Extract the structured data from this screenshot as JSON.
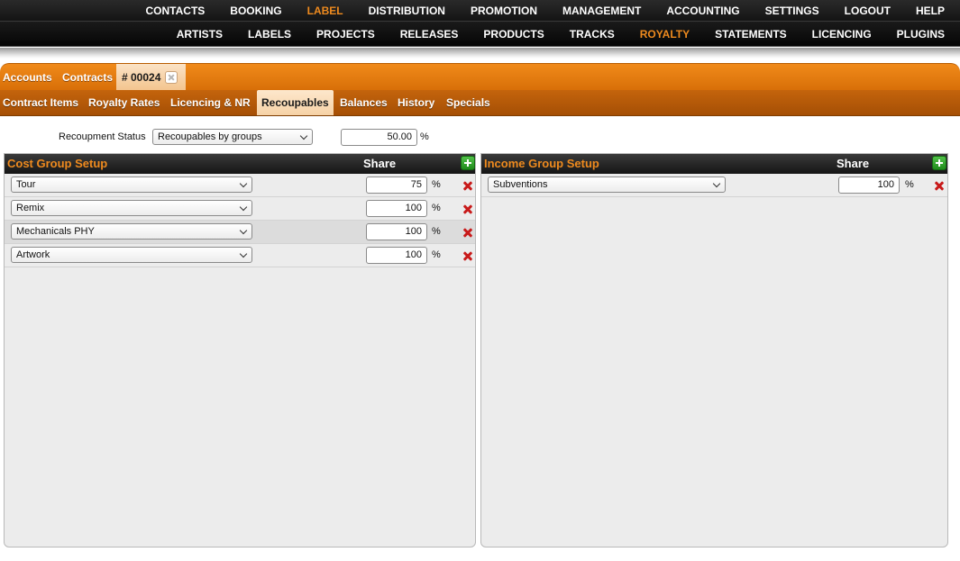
{
  "nav_top": [
    "CONTACTS",
    "BOOKING",
    "LABEL",
    "DISTRIBUTION",
    "PROMOTION",
    "MANAGEMENT",
    "ACCOUNTING",
    "SETTINGS",
    "LOGOUT",
    "HELP"
  ],
  "nav_sub": [
    "ARTISTS",
    "LABELS",
    "PROJECTS",
    "RELEASES",
    "PRODUCTS",
    "TRACKS",
    "ROYALTY",
    "STATEMENTS",
    "LICENCING",
    "PLUGINS"
  ],
  "accent_color": "#ee8a1e",
  "breadcrumb": {
    "accounts": "Accounts",
    "contracts": "Contracts",
    "current": "# 00024"
  },
  "subtabs": [
    "Contract Items",
    "Royalty Rates",
    "Licencing & NR",
    "Recoupables",
    "Balances",
    "History",
    "Specials"
  ],
  "recoupment": {
    "label": "Recoupment Status",
    "selected": "Recoupables by groups",
    "share": "50.00",
    "unit": "%"
  },
  "cost_group": {
    "title": "Cost Group Setup",
    "share_header": "Share",
    "rows": [
      {
        "name": "Tour",
        "share": "75",
        "unit": "%"
      },
      {
        "name": "Remix",
        "share": "100",
        "unit": "%"
      },
      {
        "name": "Mechanicals PHY",
        "share": "100",
        "unit": "%"
      },
      {
        "name": "Artwork",
        "share": "100",
        "unit": "%"
      }
    ]
  },
  "income_group": {
    "title": "Income Group Setup",
    "share_header": "Share",
    "rows": [
      {
        "name": "Subventions",
        "share": "100",
        "unit": "%"
      }
    ]
  }
}
